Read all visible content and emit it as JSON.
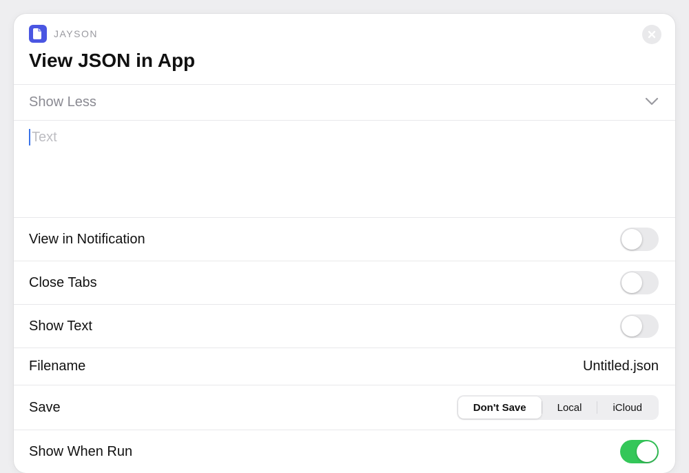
{
  "header": {
    "app_name": "JAYSON",
    "title": "View JSON in App"
  },
  "show_less": {
    "label": "Show Less"
  },
  "text_field": {
    "placeholder": "Text",
    "value": ""
  },
  "options": {
    "view_in_notification": {
      "label": "View in Notification",
      "on": false
    },
    "close_tabs": {
      "label": "Close Tabs",
      "on": false
    },
    "show_text": {
      "label": "Show Text",
      "on": false
    },
    "filename": {
      "label": "Filename",
      "value": "Untitled.json"
    },
    "save": {
      "label": "Save",
      "segments": [
        "Don't Save",
        "Local",
        "iCloud"
      ],
      "selected_index": 0
    },
    "show_when_run": {
      "label": "Show When Run",
      "on": true
    }
  }
}
